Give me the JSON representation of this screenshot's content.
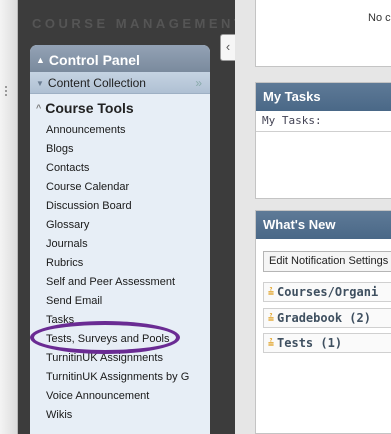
{
  "course_menu": {
    "title": "COURSE MANAGEMENT",
    "collapse_glyph": "‹",
    "control_panel": {
      "title": "Control Panel",
      "content_collection": "Content Collection",
      "content_collection_more": "»",
      "course_tools_title": "Course Tools",
      "course_tools": [
        "Announcements",
        "Blogs",
        "Contacts",
        "Course Calendar",
        "Discussion Board",
        "Glossary",
        "Journals",
        "Rubrics",
        "Self and Peer Assessment",
        "Send Email",
        "Tasks",
        "Tests, Surveys and Pools",
        "TurnitinUK Assignments",
        "TurnitinUK Assignments by G",
        "Voice Announcement",
        "Wikis"
      ]
    }
  },
  "main": {
    "top_module_text": "No c",
    "my_tasks": {
      "title": "My Tasks",
      "label": "My Tasks:"
    },
    "whats_new": {
      "title": "What's New",
      "edit_button": "Edit Notification Settings",
      "items": [
        "Courses/Organi",
        "Gradebook (2)",
        "Tests (1)"
      ]
    }
  },
  "colors": {
    "highlight": "#6a2b93",
    "menu_background": "#3c3c3c",
    "module_header": "#4a6887",
    "chevron": "#e0a020"
  }
}
